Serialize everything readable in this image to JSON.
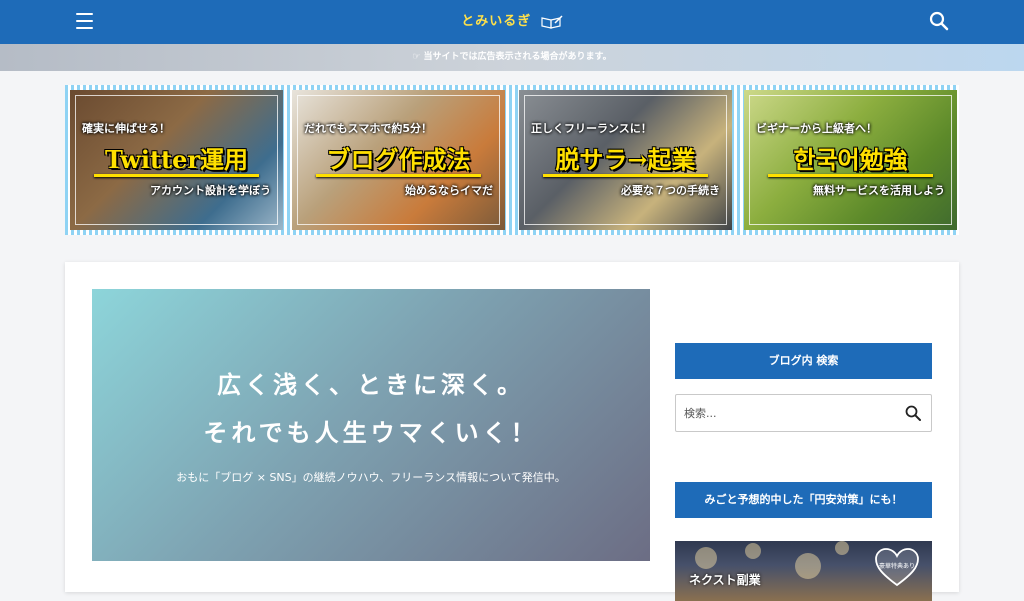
{
  "header": {
    "site_title": "とみいるぎ",
    "menu_icon": "hamburger-menu-icon",
    "search_icon": "search-icon",
    "logo_icon": "open-book-pen-icon",
    "bg_color": "#1e6bb8",
    "title_color": "#ffe14a"
  },
  "notice": {
    "icon": "pointing-hand-icon",
    "text": "☞ 当サイトでは広告表示される場合があります。"
  },
  "banners": [
    {
      "sub1": "確実に伸ばせる！",
      "main": "Twitter運用",
      "sub2": "アカウント設計を学ぼう"
    },
    {
      "sub1": "だれでもスマホで約5分！",
      "main": "ブログ作成法",
      "sub2": "始めるならイマだ"
    },
    {
      "sub1": "正しくフリーランスに！",
      "main": "脱サラ→起業",
      "sub2": "必要な７つの手続き"
    },
    {
      "sub1": "ビギナーから上級者へ！",
      "main": "한국어勉強",
      "sub2": "無料サービスを活用しよう"
    }
  ],
  "hero": {
    "line1": "広く浅く、ときに深く。",
    "line2": "それでも人生ウマくいく！",
    "description": "おもに「ブログ × SNS」の継続ノウハウ、フリーランス情報について発信中。"
  },
  "sidebar": {
    "search_widget_title": "ブログ内 検索",
    "search_placeholder": "検索...",
    "search_icon": "search-icon",
    "promo_widget_title": "みごと予想的中した「円安対策」にも！",
    "promo_badge_icon": "heart-badge-icon",
    "promo_badge_text": "豪華特典あり",
    "promo_image_text": "ネクスト副業"
  }
}
